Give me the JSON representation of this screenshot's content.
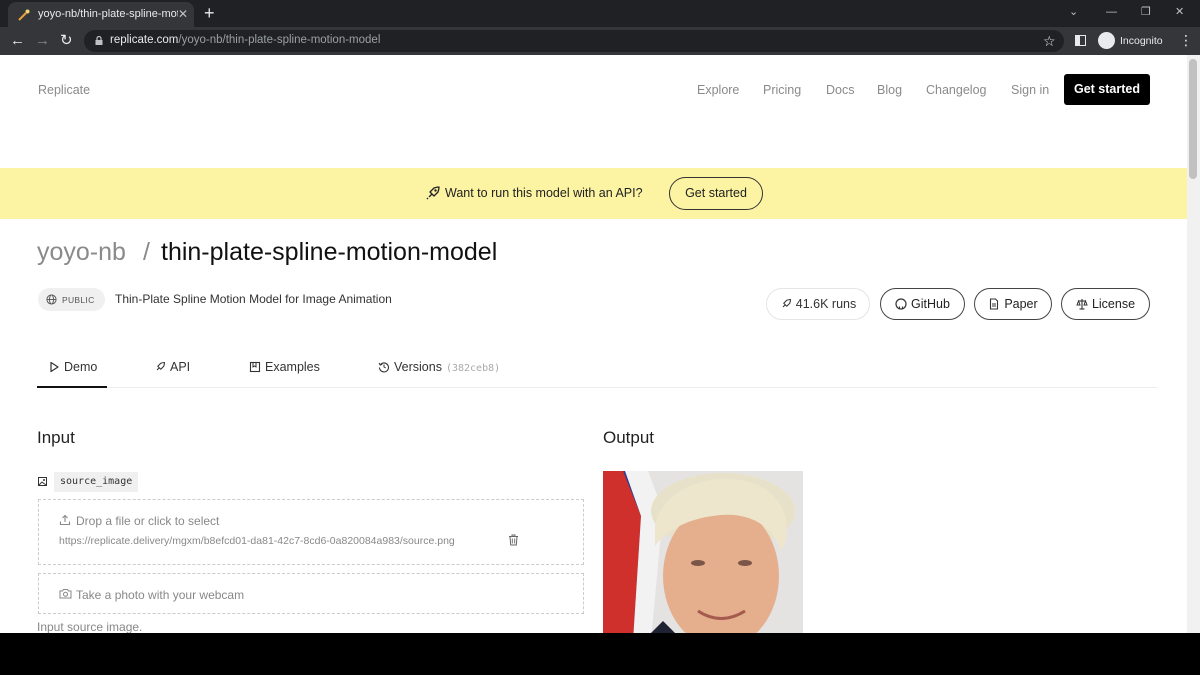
{
  "browser": {
    "tab_title": "yoyo-nb/thin-plate-spline-motio",
    "tab_close": "✕",
    "new_tab": "+",
    "url_host": "replicate.com",
    "url_path": "/yoyo-nb/thin-plate-spline-motion-model",
    "profile_label": "Incognito"
  },
  "header": {
    "brand": "Replicate",
    "nav": [
      "Explore",
      "Pricing",
      "Docs",
      "Blog",
      "Changelog",
      "Sign in"
    ],
    "cta": "Get started"
  },
  "banner": {
    "text": "Want to run this model with an API?",
    "button": "Get started"
  },
  "model": {
    "owner": "yoyo-nb",
    "separator": "/",
    "name": "thin-plate-spline-motion-model",
    "visibility": "PUBLIC",
    "description": "Thin-Plate Spline Motion Model for Image Animation",
    "runs": "41.6K runs",
    "links": [
      "GitHub",
      "Paper",
      "License"
    ]
  },
  "tabs": {
    "demo": "Demo",
    "api": "API",
    "examples": "Examples",
    "versions": "Versions",
    "version_hash": "(382ceb8)"
  },
  "input": {
    "heading": "Input",
    "field_name": "source_image",
    "drop_label": "Drop a file or click to select",
    "file_url": "https://replicate.delivery/mgxm/b8efcd01-da81-42c7-8cd6-0a820084a983/source.png",
    "webcam_label": "Take a photo with your webcam",
    "hint": "Input source image."
  },
  "output": {
    "heading": "Output"
  }
}
